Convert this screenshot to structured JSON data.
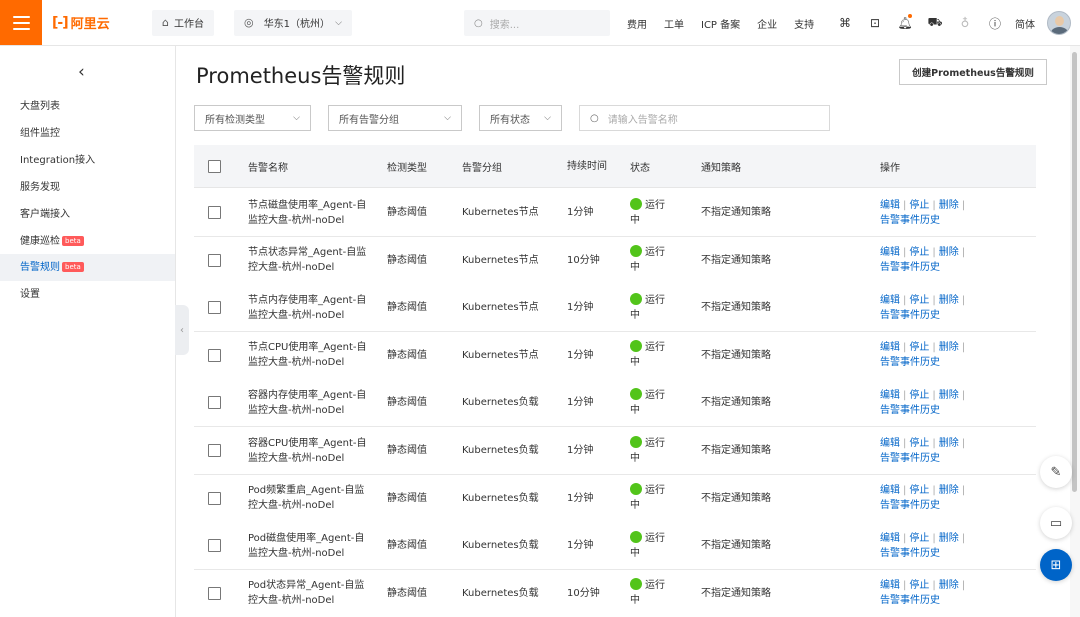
{
  "header": {
    "brand": "阿里云",
    "workbench": "工作台",
    "region": "华东1（杭州）",
    "search_placeholder": "搜索...",
    "links": [
      "费用",
      "工单",
      "ICP 备案",
      "企业",
      "支持"
    ],
    "lang": "简体"
  },
  "sidebar": {
    "items": [
      {
        "label": "大盘列表",
        "beta": ""
      },
      {
        "label": "组件监控",
        "beta": ""
      },
      {
        "label": "Integration接入",
        "beta": ""
      },
      {
        "label": "服务发现",
        "beta": ""
      },
      {
        "label": "客户端接入",
        "beta": ""
      },
      {
        "label": "健康巡检",
        "beta": "beta"
      },
      {
        "label": "告警规则",
        "beta": "beta",
        "active": true
      },
      {
        "label": "设置",
        "beta": ""
      }
    ]
  },
  "page": {
    "title": "Prometheus告警规则",
    "create_button": "创建Prometheus告警规则"
  },
  "filters": {
    "detect_type": "所有检测类型",
    "alert_group": "所有告警分组",
    "status": "所有状态",
    "name_placeholder": "请输入告警名称"
  },
  "table": {
    "columns": [
      "告警名称",
      "检测类型",
      "告警分组",
      "持续时间",
      "状态",
      "通知策略",
      "操作"
    ],
    "rows": [
      {
        "name": "节点磁盘使用率_Agent-自监控大盘-杭州-noDel",
        "type": "静态阈值",
        "group": "Kubernetes节点",
        "duration": "1分钟",
        "status": "运行中",
        "policy": "不指定通知策略"
      },
      {
        "name": "节点状态异常_Agent-自监控大盘-杭州-noDel",
        "type": "静态阈值",
        "group": "Kubernetes节点",
        "duration": "10分钟",
        "status": "运行中",
        "policy": "不指定通知策略"
      },
      {
        "name": "节点内存使用率_Agent-自监控大盘-杭州-noDel",
        "type": "静态阈值",
        "group": "Kubernetes节点",
        "duration": "1分钟",
        "status": "运行中",
        "policy": "不指定通知策略"
      },
      {
        "name": "节点CPU使用率_Agent-自监控大盘-杭州-noDel",
        "type": "静态阈值",
        "group": "Kubernetes节点",
        "duration": "1分钟",
        "status": "运行中",
        "policy": "不指定通知策略"
      },
      {
        "name": "容器内存使用率_Agent-自监控大盘-杭州-noDel",
        "type": "静态阈值",
        "group": "Kubernetes负载",
        "duration": "1分钟",
        "status": "运行中",
        "policy": "不指定通知策略"
      },
      {
        "name": "容器CPU使用率_Agent-自监控大盘-杭州-noDel",
        "type": "静态阈值",
        "group": "Kubernetes负载",
        "duration": "1分钟",
        "status": "运行中",
        "policy": "不指定通知策略"
      },
      {
        "name": "Pod频繁重启_Agent-自监控大盘-杭州-noDel",
        "type": "静态阈值",
        "group": "Kubernetes负载",
        "duration": "1分钟",
        "status": "运行中",
        "policy": "不指定通知策略"
      },
      {
        "name": "Pod磁盘使用率_Agent-自监控大盘-杭州-noDel",
        "type": "静态阈值",
        "group": "Kubernetes负载",
        "duration": "1分钟",
        "status": "运行中",
        "policy": "不指定通知策略"
      },
      {
        "name": "Pod状态异常_Agent-自监控大盘-杭州-noDel",
        "type": "静态阈值",
        "group": "Kubernetes负载",
        "duration": "10分钟",
        "status": "运行中",
        "policy": "不指定通知策略"
      }
    ],
    "actions": {
      "edit": "编辑",
      "stop": "停止",
      "delete": "删除",
      "history": "告警事件历史"
    }
  },
  "colors": {
    "brand": "#ff6a00",
    "link": "#0064c8",
    "running": "#52c41a",
    "beta": "#ff5a5a"
  }
}
